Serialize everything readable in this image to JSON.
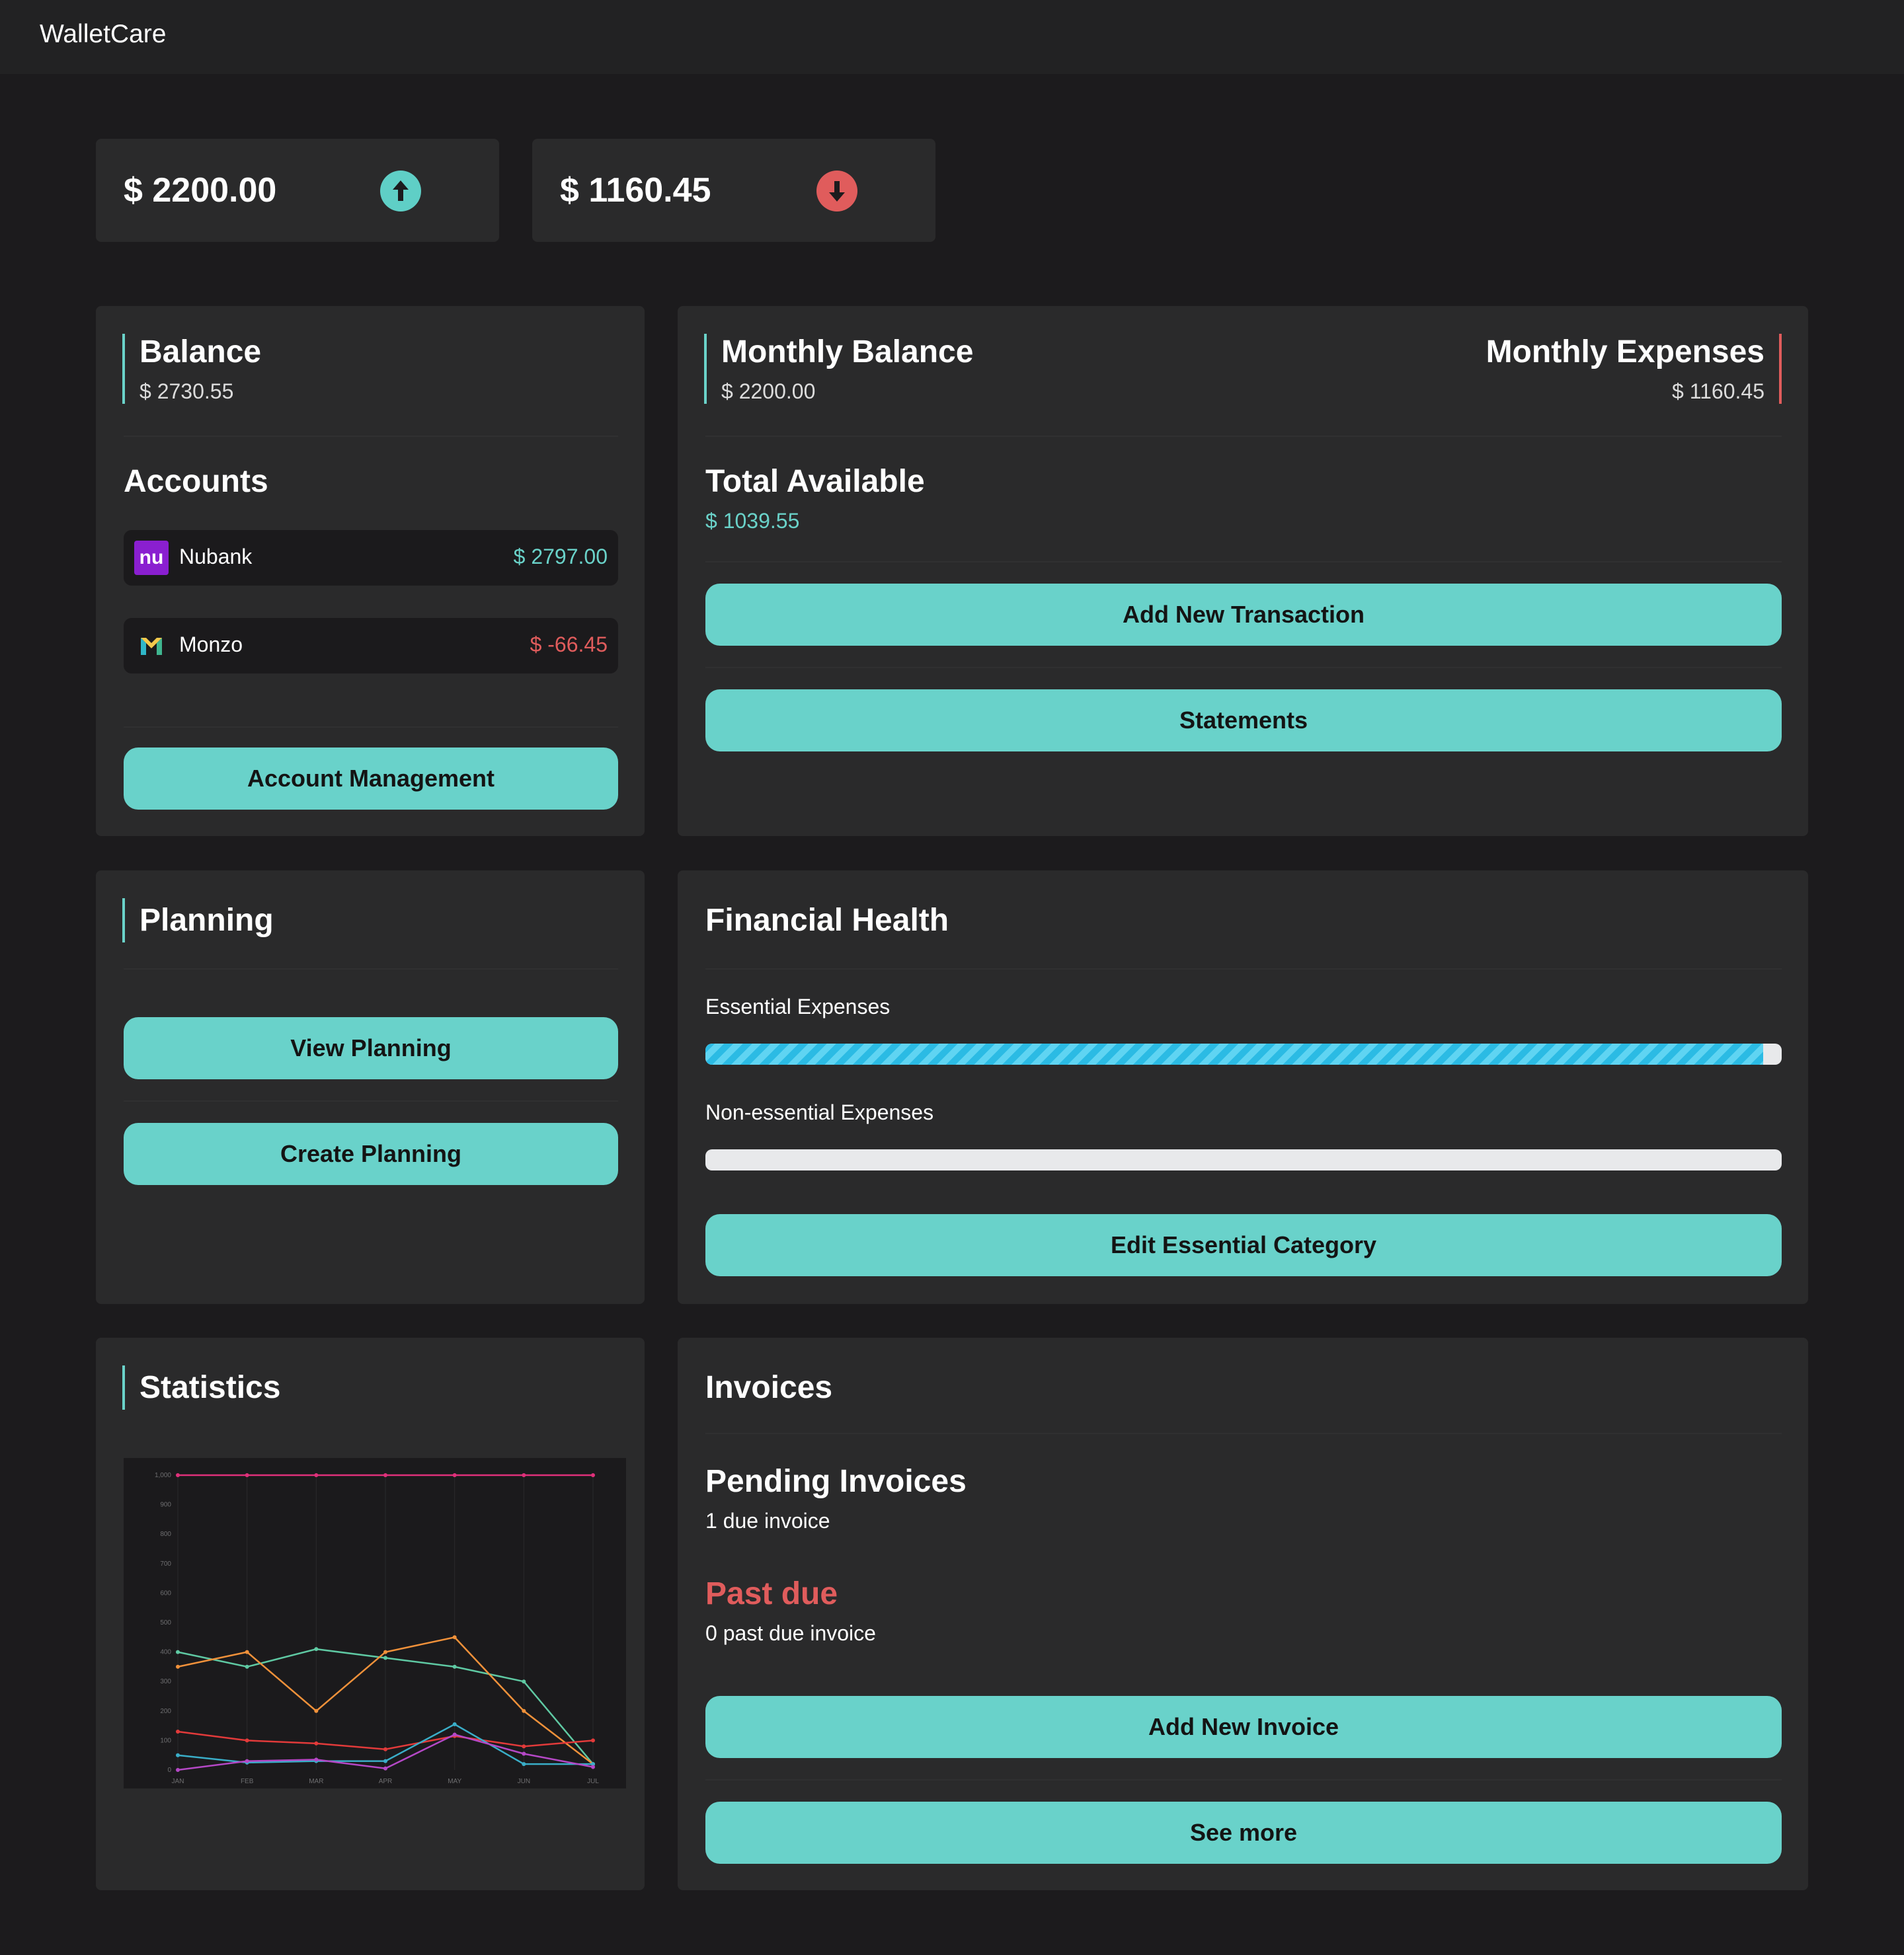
{
  "app": {
    "title": "WalletCare"
  },
  "summary": {
    "income": "$ 2200.00",
    "expense": "$ 1160.45"
  },
  "balance": {
    "title": "Balance",
    "value": "$ 2730.55"
  },
  "accounts": {
    "title": "Accounts",
    "items": [
      {
        "name": "Nubank",
        "value": "$ 2797.00",
        "logo_text": "nu",
        "color": "#6ad2c9"
      },
      {
        "name": "Monzo",
        "value": "$ -66.45",
        "logo_text": "M",
        "color": "#e05c5c"
      }
    ],
    "manage_label": "Account Management"
  },
  "monthly": {
    "balance_title": "Monthly Balance",
    "balance_value": "$ 2200.00",
    "expenses_title": "Monthly Expenses",
    "expenses_value": "$ 1160.45",
    "available_title": "Total Available",
    "available_value": "$ 1039.55",
    "add_transaction_label": "Add New Transaction",
    "statements_label": "Statements"
  },
  "planning": {
    "title": "Planning",
    "view_label": "View Planning",
    "create_label": "Create Planning"
  },
  "health": {
    "title": "Financial Health",
    "essential_label": "Essential Expenses",
    "essential_progress": 0.983,
    "nonessential_label": "Non-essential Expenses",
    "nonessential_progress": 0,
    "edit_label": "Edit Essential Category"
  },
  "statistics": {
    "title": "Statistics"
  },
  "invoices": {
    "title": "Invoices",
    "pending_title": "Pending Invoices",
    "pending_text": "1 due invoice",
    "pastdue_title": "Past due",
    "pastdue_text": "0 past due invoice",
    "add_label": "Add New Invoice",
    "more_label": "See more"
  },
  "colors": {
    "accent": "#69d2ca",
    "negative": "#e05c5c",
    "background": "#1c1b1d",
    "card": "#2a2a2b"
  },
  "chart_data": {
    "type": "line",
    "categories": [
      "JAN",
      "FEB",
      "MAR",
      "APR",
      "MAY",
      "JUN",
      "JUL"
    ],
    "ylim": [
      0,
      1000
    ],
    "yticks": [
      0,
      100,
      200,
      300,
      400,
      500,
      600,
      700,
      800,
      900,
      "1,000"
    ],
    "series": [
      {
        "color": "#e0307a",
        "values": [
          1000,
          1000,
          1000,
          1000,
          1000,
          1000,
          1000
        ]
      },
      {
        "color": "#5fc9a3",
        "values": [
          400,
          350,
          410,
          380,
          350,
          300,
          20
        ]
      },
      {
        "color": "#f0913a",
        "values": [
          350,
          400,
          200,
          400,
          450,
          200,
          20
        ]
      },
      {
        "color": "#e23a3a",
        "values": [
          130,
          100,
          90,
          70,
          115,
          80,
          100
        ]
      },
      {
        "color": "#3aaec8",
        "values": [
          50,
          25,
          30,
          30,
          155,
          20,
          20
        ]
      },
      {
        "color": "#b548c6",
        "values": [
          0,
          30,
          35,
          5,
          120,
          55,
          10
        ]
      }
    ]
  }
}
